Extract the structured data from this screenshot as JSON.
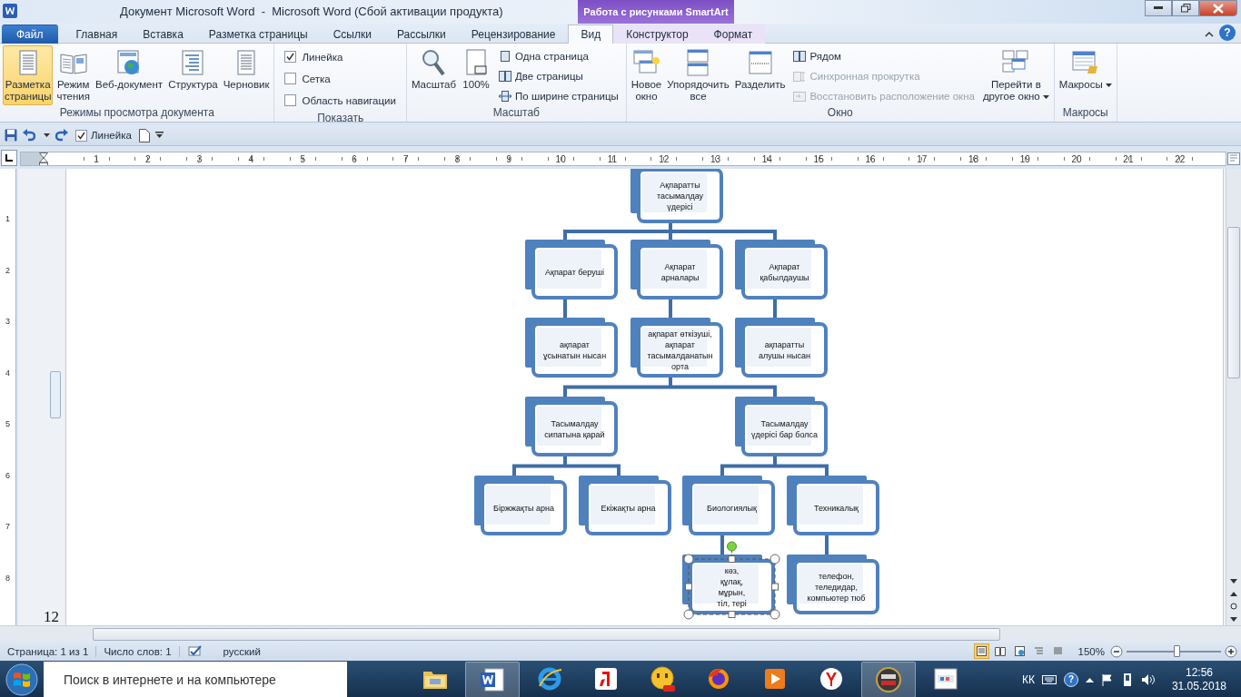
{
  "window": {
    "title": "Документ Microsoft Word  -  Microsoft Word (Сбой активации продукта)",
    "context_group": "Работа с рисунками SmartArt",
    "help": "?"
  },
  "tabs": [
    {
      "label": "Файл",
      "kind": "file",
      "selected": false
    },
    {
      "label": "Главная",
      "kind": "normal",
      "selected": false
    },
    {
      "label": "Вставка",
      "kind": "normal",
      "selected": false
    },
    {
      "label": "Разметка страницы",
      "kind": "normal",
      "selected": false
    },
    {
      "label": "Ссылки",
      "kind": "normal",
      "selected": false
    },
    {
      "label": "Рассылки",
      "kind": "normal",
      "selected": false
    },
    {
      "label": "Рецензирование",
      "kind": "normal",
      "selected": false
    },
    {
      "label": "Вид",
      "kind": "normal",
      "selected": true
    },
    {
      "label": "Конструктор",
      "kind": "contextual",
      "selected": false
    },
    {
      "label": "Формат",
      "kind": "contextual",
      "selected": false
    }
  ],
  "ribbon": {
    "groups": [
      {
        "label": "Режимы просмотра документа",
        "items": [
          {
            "kind": "large",
            "label": "Разметка\nстраницы",
            "selected": true
          },
          {
            "kind": "large",
            "label": "Режим\nчтения",
            "selected": false
          },
          {
            "kind": "large",
            "label": "Веб-документ",
            "selected": false
          },
          {
            "kind": "large",
            "label": "Структура",
            "selected": false
          },
          {
            "kind": "large",
            "label": "Черновик",
            "selected": false
          }
        ]
      },
      {
        "label": "Показать",
        "items": [
          {
            "kind": "check",
            "label": "Линейка",
            "checked": true
          },
          {
            "kind": "check",
            "label": "Сетка",
            "checked": false
          },
          {
            "kind": "check",
            "label": "Область навигации",
            "checked": false
          }
        ]
      },
      {
        "label": "Масштаб",
        "items": [
          {
            "kind": "large",
            "label": "Масштаб",
            "selected": false
          },
          {
            "kind": "large",
            "label": "100%",
            "selected": false
          },
          {
            "kind": "small",
            "label": "Одна страница",
            "disabled": false
          },
          {
            "kind": "small",
            "label": "Две страницы",
            "disabled": false
          },
          {
            "kind": "small",
            "label": "По ширине страницы",
            "disabled": false
          }
        ]
      },
      {
        "label": "Окно",
        "items": [
          {
            "kind": "large",
            "label": "Новое\nокно",
            "selected": false
          },
          {
            "kind": "large",
            "label": "Упорядочить\nвсе",
            "selected": false
          },
          {
            "kind": "large",
            "label": "Разделить",
            "selected": false
          },
          {
            "kind": "small",
            "label": "Рядом",
            "disabled": false
          },
          {
            "kind": "small",
            "label": "Синхронная прокрутка",
            "disabled": true
          },
          {
            "kind": "small",
            "label": "Восстановить расположение окна",
            "disabled": true
          },
          {
            "kind": "large",
            "label": "Перейти в\nдругое окно",
            "selected": false,
            "dropdown": true
          }
        ]
      },
      {
        "label": "Макросы",
        "items": [
          {
            "kind": "large",
            "label": "Макросы",
            "selected": false,
            "dropdown": true
          }
        ]
      }
    ]
  },
  "quick_access": {
    "ruler_checkbox": {
      "label": "Линейка",
      "checked": true
    }
  },
  "ruler": {
    "numbers": [
      "1",
      "2",
      "3",
      "4",
      "5",
      "6",
      "7",
      "8",
      "9",
      "10",
      "11",
      "12",
      "13",
      "14",
      "15",
      "16",
      "17",
      "18",
      "19",
      "20",
      "21",
      "22"
    ]
  },
  "vertical_ruler": {
    "numbers": [
      "1",
      "2",
      "3",
      "4",
      "5",
      "6",
      "7",
      "8"
    ]
  },
  "document": {
    "page_number": "12",
    "diagram": {
      "text": "Ақпаратты тасымалдау үдерісі",
      "selected": false,
      "children": [
        {
          "text": "Ақпарат беруші",
          "selected": false,
          "children": [
            {
              "text": "ақпарат ұсынатын нысан",
              "selected": false
            }
          ]
        },
        {
          "text": "Ақпарат арналары",
          "selected": false,
          "children": [
            {
              "text": "ақпарат өткізуші, ақпарат тасымалданатын орта",
              "selected": false,
              "children": [
                {
                  "text": "Тасымалдау сипатына қарай",
                  "selected": false,
                  "children": [
                    {
                      "text": "Біржжақты арна",
                      "selected": false
                    },
                    {
                      "text": "Екіжақты  арна",
                      "selected": false
                    }
                  ]
                },
                {
                  "text": "Тасымалдау үдерісі бар болса",
                  "selected": false,
                  "children": [
                    {
                      "text": "Биологиялық",
                      "selected": false,
                      "children": [
                        {
                          "text": "көз,\nқұлақ,\nмұрын,\nтіл, тері",
                          "selected": true
                        }
                      ]
                    },
                    {
                      "text": "Техникалық",
                      "selected": false,
                      "children": [
                        {
                          "text": "телефон, теледидар, компьютер тюб",
                          "selected": false
                        }
                      ]
                    }
                  ]
                }
              ]
            }
          ]
        },
        {
          "text": "Ақпарат қабылдаушы",
          "selected": false,
          "children": [
            {
              "text": "ақпаратты алушы нысан",
              "selected": false
            }
          ]
        }
      ]
    }
  },
  "status_bar": {
    "page": "Страница: 1 из 1",
    "words": "Число слов: 1",
    "language": "русский",
    "zoom": "150%",
    "zoom_level": {
      "level": 0.55
    }
  },
  "taskbar": {
    "search_placeholder": "Поиск в интернете и на компьютере",
    "language": "КК",
    "help": "?",
    "time": "12:56",
    "date": "31.05.2018"
  }
}
